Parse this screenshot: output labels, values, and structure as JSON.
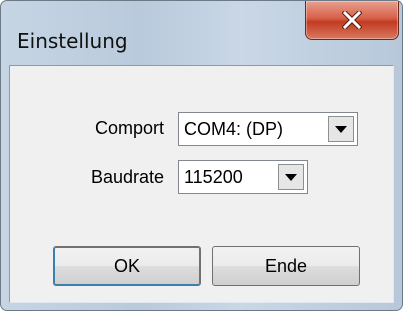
{
  "window": {
    "title": "Einstellung",
    "close_icon": "close-icon"
  },
  "form": {
    "comport_label": "Comport",
    "comport_value": "COM4: (DP)",
    "baudrate_label": "Baudrate",
    "baudrate_value": "115200"
  },
  "buttons": {
    "ok_label": "OK",
    "end_label": "Ende"
  },
  "colors": {
    "close_button": "#c9452c",
    "title_bar": "#c2d2e3",
    "client_area": "#f0f0f0"
  }
}
